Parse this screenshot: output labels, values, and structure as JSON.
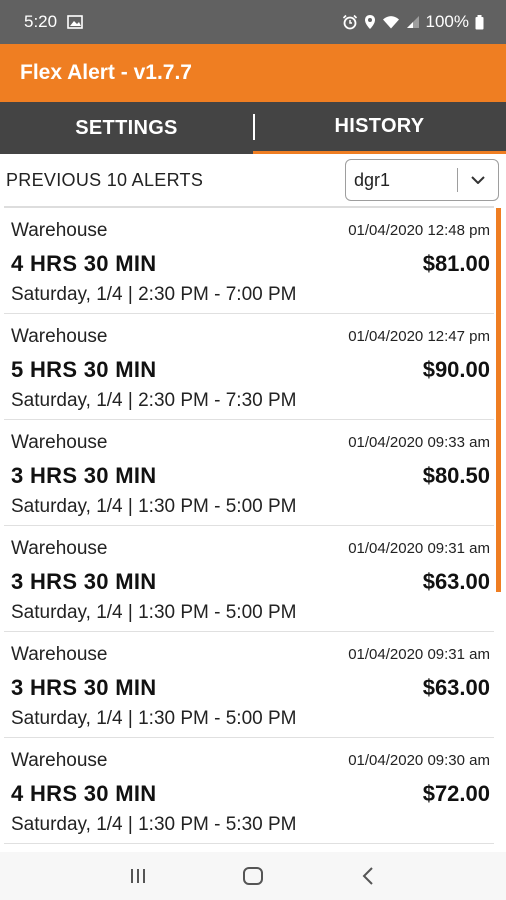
{
  "status_bar": {
    "time": "5:20",
    "battery": "100%",
    "icons": [
      "image-icon",
      "alarm-icon",
      "location-icon",
      "wifi-icon",
      "signal-icon",
      "battery-icon"
    ]
  },
  "app_bar": {
    "title": "Flex Alert - v1.7.7",
    "color": "#ef7e22"
  },
  "tabs": [
    {
      "label": "SETTINGS",
      "active": false
    },
    {
      "label": "HISTORY",
      "active": true
    }
  ],
  "history": {
    "heading": "PREVIOUS 10 ALERTS",
    "filter": {
      "selected": "dgr1"
    }
  },
  "alerts": [
    {
      "location": "Warehouse",
      "timestamp": "01/04/2020 12:48 pm",
      "duration": "4 HRS 30 MIN",
      "pay": "$81.00",
      "schedule": "Saturday, 1/4 | 2:30 PM - 7:00 PM"
    },
    {
      "location": "Warehouse",
      "timestamp": "01/04/2020 12:47 pm",
      "duration": "5 HRS 30 MIN",
      "pay": "$90.00",
      "schedule": "Saturday, 1/4 | 2:30 PM - 7:30 PM"
    },
    {
      "location": "Warehouse",
      "timestamp": "01/04/2020 09:33 am",
      "duration": "3 HRS 30 MIN",
      "pay": "$80.50",
      "schedule": "Saturday, 1/4 | 1:30 PM - 5:00 PM"
    },
    {
      "location": "Warehouse",
      "timestamp": "01/04/2020 09:31 am",
      "duration": "3 HRS 30 MIN",
      "pay": "$63.00",
      "schedule": "Saturday, 1/4 | 1:30 PM - 5:00 PM"
    },
    {
      "location": "Warehouse",
      "timestamp": "01/04/2020 09:31 am",
      "duration": "3 HRS 30 MIN",
      "pay": "$63.00",
      "schedule": "Saturday, 1/4 | 1:30 PM - 5:00 PM"
    },
    {
      "location": "Warehouse",
      "timestamp": "01/04/2020 09:30 am",
      "duration": "4 HRS 30 MIN",
      "pay": "$72.00",
      "schedule": "Saturday, 1/4 | 1:30 PM - 5:30 PM"
    }
  ],
  "nav_bar": {
    "icons": [
      "recent-apps-icon",
      "home-icon",
      "back-icon"
    ]
  }
}
